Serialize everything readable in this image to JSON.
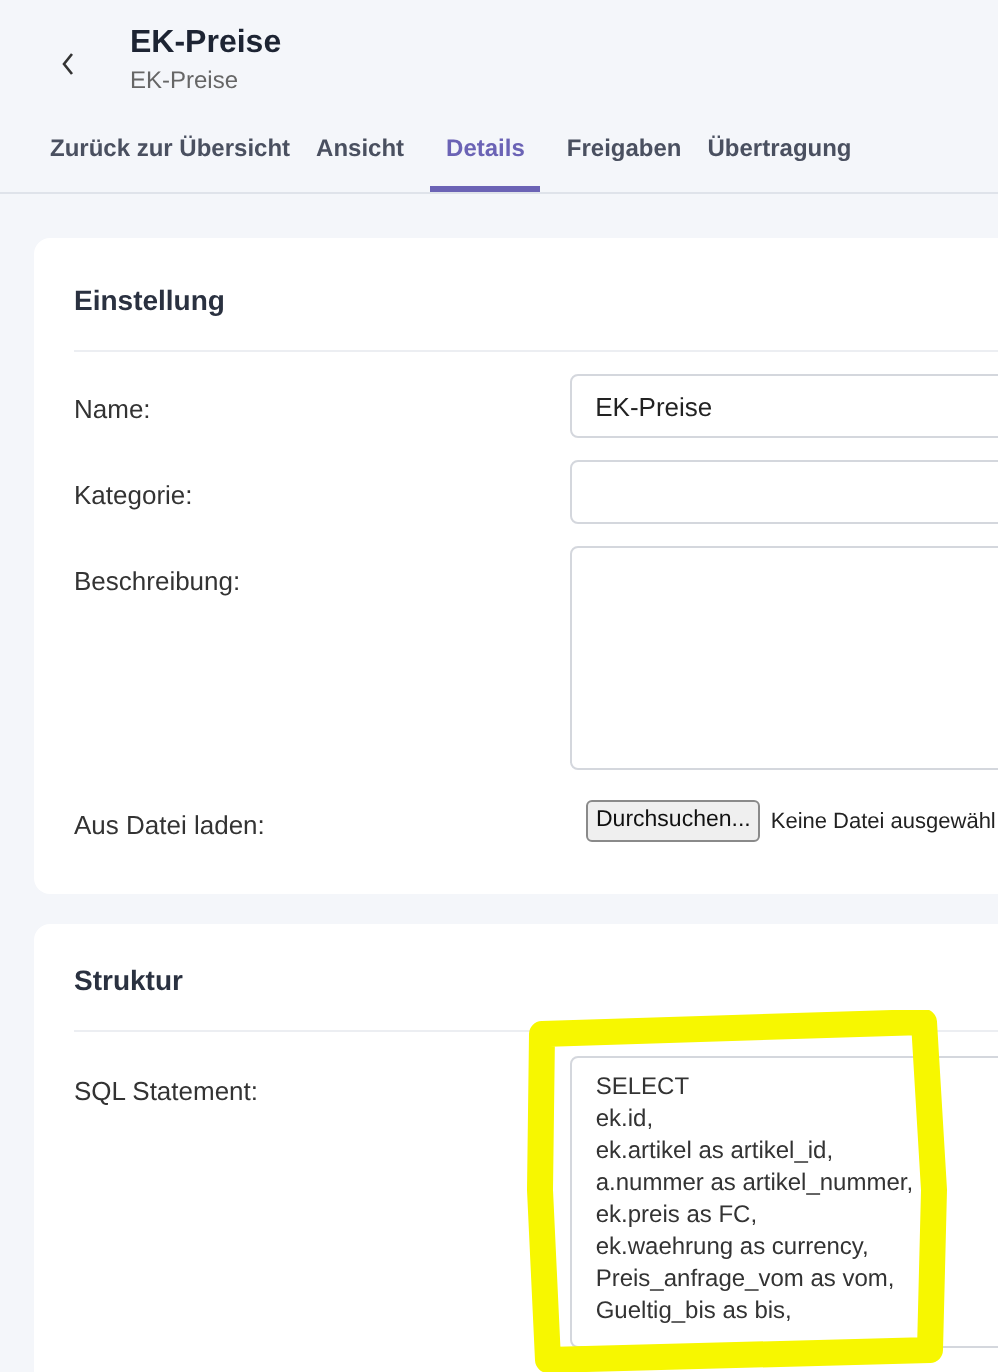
{
  "header": {
    "title": "EK-Preise",
    "subtitle": "EK-Preise"
  },
  "tabs": [
    {
      "label": "Zurück zur Übersicht",
      "selected": false
    },
    {
      "label": "Ansicht",
      "selected": false
    },
    {
      "label": "Details",
      "selected": true
    },
    {
      "label": "Freigaben",
      "selected": false
    },
    {
      "label": "Übertragung",
      "selected": false
    }
  ],
  "einstellung": {
    "title": "Einstellung",
    "fields": [
      {
        "kind": "text",
        "label": "Name:",
        "value": "EK-Preise"
      },
      {
        "kind": "text",
        "label": "Kategorie:"
      },
      {
        "kind": "textarea",
        "label": "Beschreibung:"
      },
      {
        "kind": "file",
        "label": "Aus Datei laden:",
        "button": "Durchsuchen...",
        "status": "Keine Datei ausgewähl"
      }
    ]
  },
  "struktur": {
    "title": "Struktur",
    "sql_label": "SQL Statement:",
    "sql_lines": [
      "SELECT",
      "ek.id,",
      "ek.artikel as artikel_id,",
      "a.nummer as artikel_nummer,",
      "ek.preis as FC,",
      "ek.waehrung as currency,",
      "Preis_anfrage_vom as vom,",
      "Gueltig_bis as bis,"
    ]
  }
}
